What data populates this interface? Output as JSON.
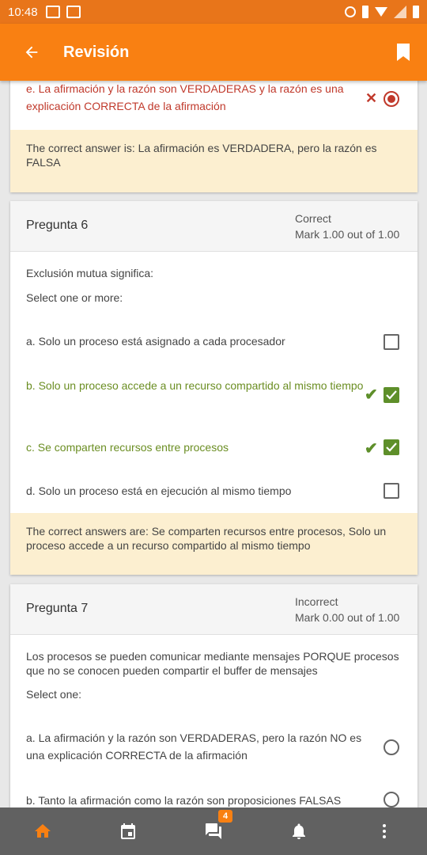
{
  "status_bar": {
    "time": "10:48"
  },
  "app_bar": {
    "title": "Revisión"
  },
  "prev_question": {
    "option_e": "e. La afirmación y la razón son VERDADERAS y la razón es una explicación CORRECTA de la afirmación",
    "feedback": "The correct answer is: La afirmación es VERDADERA, pero la razón es FALSA"
  },
  "q6": {
    "title": "Pregunta 6",
    "status": "Correct",
    "mark": "Mark 1.00 out of 1.00",
    "text": "Exclusión mutua significa:",
    "instruction": "Select one or more:",
    "options": [
      {
        "label": "a. Solo un proceso está asignado a cada procesador",
        "checked": false,
        "correct": false
      },
      {
        "label": "b. Solo un proceso accede a un recurso compartido al mismo tiempo",
        "checked": true,
        "correct": true
      },
      {
        "label": "c. Se comparten recursos entre procesos",
        "checked": true,
        "correct": true
      },
      {
        "label": "d. Solo un proceso está en ejecución al mismo tiempo",
        "checked": false,
        "correct": false
      }
    ],
    "feedback": "The correct answers are: Se comparten recursos entre procesos, Solo un proceso accede a un recurso compartido al mismo tiempo"
  },
  "q7": {
    "title": "Pregunta 7",
    "status": "Incorrect",
    "mark": "Mark 0.00 out of 1.00",
    "text": "Los procesos se pueden comunicar mediante mensajes PORQUE procesos que no se conocen pueden compartir el buffer de mensajes",
    "instruction": "Select one:",
    "options": [
      {
        "label": "a. La afirmación y la razón son VERDADERAS, pero la razón NO es una explicación CORRECTA de la afirmación"
      },
      {
        "label": "b. Tanto la afirmación como la razón son proposiciones FALSAS"
      }
    ]
  },
  "bottom_nav": {
    "messages_badge": "4"
  },
  "colors": {
    "accent": "#f98012",
    "correct": "#5e8f2a",
    "incorrect": "#c0392b",
    "feedback_bg": "#fcefd0"
  }
}
